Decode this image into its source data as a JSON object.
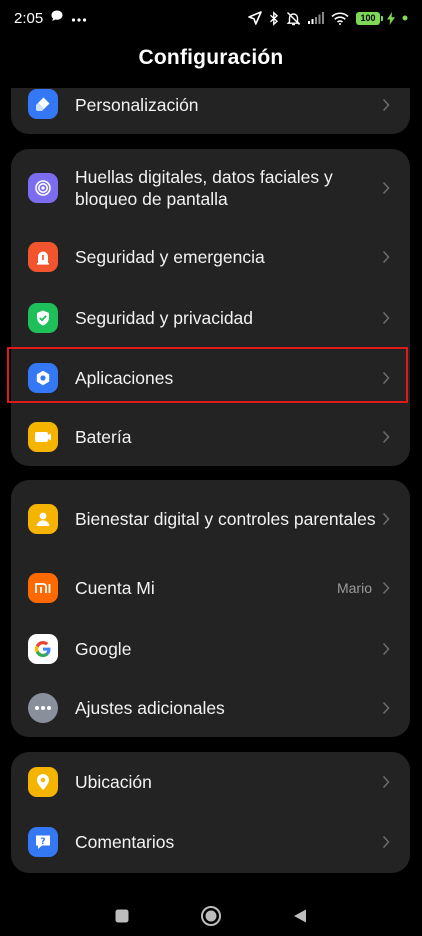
{
  "status": {
    "time": "2:05",
    "battery": "100",
    "colors": {
      "battery": "#7ed957"
    }
  },
  "title": "Configuración",
  "cards": [
    {
      "items": [
        {
          "id": "personalizacion",
          "label": "Personalización",
          "icon": "paintbrush-icon",
          "color": "#3478f6"
        }
      ]
    },
    {
      "items": [
        {
          "id": "huellas",
          "label": "Huellas digitales, datos faciales y bloqueo de pantalla",
          "icon": "fingerprint-icon",
          "color": "#7c6cf0"
        },
        {
          "id": "seguridad-emergencia",
          "label": "Seguridad y emergencia",
          "icon": "emergency-icon",
          "color": "#f2542d"
        },
        {
          "id": "seguridad-privacidad",
          "label": "Seguridad y privacidad",
          "icon": "shield-check-icon",
          "color": "#1fbf5a"
        },
        {
          "id": "aplicaciones",
          "label": "Aplicaciones",
          "icon": "apps-gear-icon",
          "color": "#3478f6"
        },
        {
          "id": "bateria",
          "label": "Batería",
          "icon": "battery-icon",
          "color": "#f5b400"
        }
      ]
    },
    {
      "items": [
        {
          "id": "bienestar",
          "label": "Bienestar digital y controles parentales",
          "icon": "person-icon",
          "color": "#f5b400"
        },
        {
          "id": "cuenta-mi",
          "label": "Cuenta Mi",
          "value": "Mario",
          "icon": "mi-logo-icon",
          "color": "#ff6a00"
        },
        {
          "id": "google",
          "label": "Google",
          "icon": "google-icon",
          "color": "#ffffff"
        },
        {
          "id": "ajustes-adicionales",
          "label": "Ajustes adicionales",
          "icon": "more-dots-icon",
          "color": "#8a8f9c"
        }
      ]
    },
    {
      "items": [
        {
          "id": "ubicacion",
          "label": "Ubicación",
          "icon": "location-pin-icon",
          "color": "#f5b400"
        },
        {
          "id": "comentarios",
          "label": "Comentarios",
          "icon": "feedback-icon",
          "color": "#3478f6"
        }
      ]
    }
  ],
  "highlight_target": "Aplicaciones"
}
